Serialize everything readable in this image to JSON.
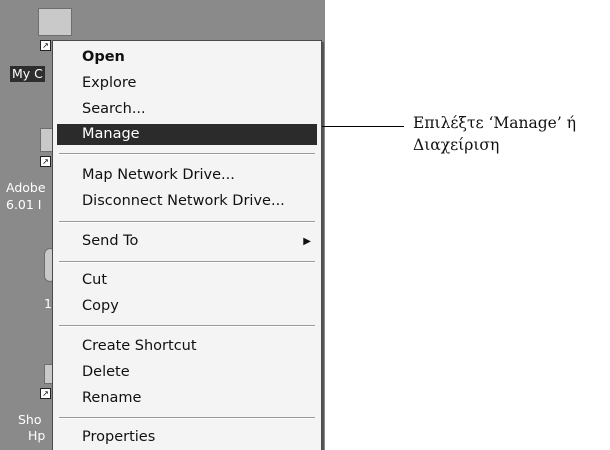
{
  "desktop_icons": [
    {
      "label": "My C",
      "selected": true
    },
    {
      "label": "Adobe",
      "label2": "6.01 I"
    },
    {
      "label": "1"
    },
    {
      "label": "Sho",
      "label2": "Hp"
    }
  ],
  "context_menu": {
    "groups": [
      [
        {
          "label": "Open",
          "bold": true
        },
        {
          "label": "Explore"
        },
        {
          "label": "Search..."
        },
        {
          "label": "Manage",
          "highlighted": true
        }
      ],
      [
        {
          "label": "Map Network Drive..."
        },
        {
          "label": "Disconnect Network Drive..."
        }
      ],
      [
        {
          "label": "Send To",
          "submenu_arrow": "▶"
        }
      ],
      [
        {
          "label": "Cut"
        },
        {
          "label": "Copy"
        }
      ],
      [
        {
          "label": "Create Shortcut"
        },
        {
          "label": "Delete"
        },
        {
          "label": "Rename"
        }
      ],
      [
        {
          "label": "Properties"
        }
      ]
    ]
  },
  "callout": {
    "line1": "Επιλέξτε ‘Manage’ ή",
    "line2": "Διαχείριση"
  },
  "colors": {
    "desktop_bg": "#8a8a8a",
    "menu_bg": "#f4f4f4",
    "highlight_bg": "#2b2b2b"
  }
}
